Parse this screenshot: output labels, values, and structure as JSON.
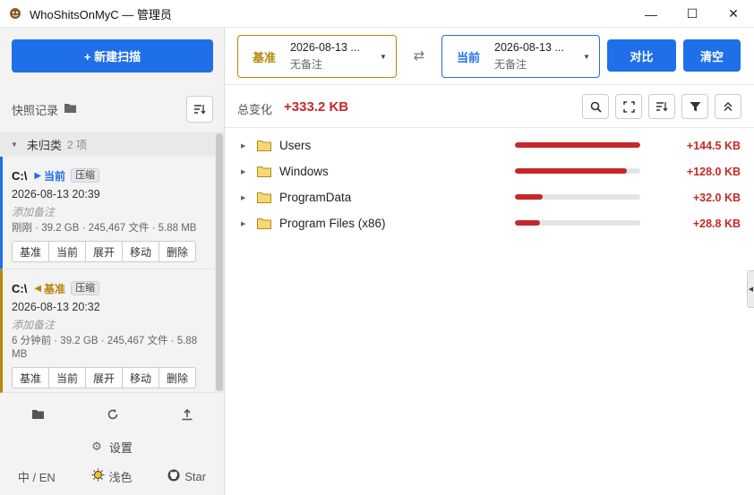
{
  "window": {
    "title": "WhoShitsOnMyC — 管理员",
    "controls": {
      "minimize": "—",
      "maximize": "☐",
      "close": "✕"
    }
  },
  "sidebar": {
    "new_scan": "+ 新建扫描",
    "snapshots_label": "快照记录",
    "group": {
      "name": "未归类",
      "count": "2 项"
    },
    "cards": [
      {
        "drive": "C:\\",
        "tag": "当前",
        "tag_color": "#1f6fe8",
        "compress": "压缩",
        "time": "2026-08-13 20:39",
        "note": "添加备注",
        "meta": "刚刚 · 39.2 GB · 245,467 文件 · 5.88 MB",
        "actions": [
          "基准",
          "当前",
          "展开",
          "移动",
          "删除"
        ]
      },
      {
        "drive": "C:\\",
        "tag": "基准",
        "tag_color": "#b8860b",
        "compress": "压缩",
        "time": "2026-08-13 20:32",
        "note": "添加备注",
        "meta": "6 分钟前 · 39.2 GB · 245,467 文件 · 5.88 MB",
        "actions": [
          "基准",
          "当前",
          "展开",
          "移动",
          "删除"
        ]
      }
    ],
    "settings": "设置",
    "footer": {
      "lang": "中 / EN",
      "theme": "浅色",
      "star": "Star"
    }
  },
  "compare": {
    "base": {
      "kind": "基准",
      "date": "2026-08-13 ...",
      "sub": "无备注"
    },
    "current": {
      "kind": "当前",
      "date": "2026-08-13 ...",
      "sub": "无备注"
    },
    "compare_btn": "对比",
    "clear_btn": "清空"
  },
  "summary": {
    "label": "总变化",
    "value": "+333.2 KB"
  },
  "rows": [
    {
      "name": "Users",
      "delta": "+144.5 KB",
      "fill": 1.0
    },
    {
      "name": "Windows",
      "delta": "+128.0 KB",
      "fill": 0.89
    },
    {
      "name": "ProgramData",
      "delta": "+32.0 KB",
      "fill": 0.22
    },
    {
      "name": "Program Files (x86)",
      "delta": "+28.8 KB",
      "fill": 0.2
    }
  ],
  "colors": {
    "primary": "#1f6fe8",
    "base": "#b8860b",
    "increase": "#c62828"
  }
}
